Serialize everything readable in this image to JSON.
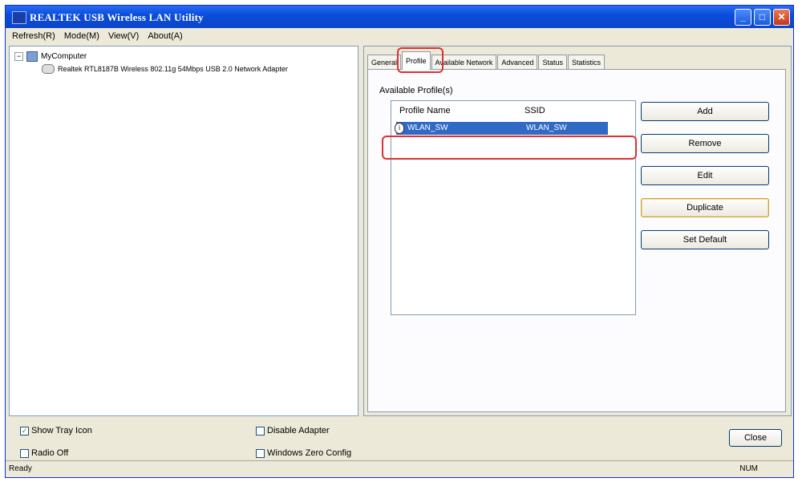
{
  "window": {
    "title": "REALTEK USB Wireless LAN Utility"
  },
  "menu": [
    "Refresh(R)",
    "Mode(M)",
    "View(V)",
    "About(A)"
  ],
  "tree": {
    "root": "MyComputer",
    "child": "Realtek RTL8187B Wireless 802.11g 54Mbps USB 2.0 Network Adapter"
  },
  "tabs": [
    "General",
    "Profile",
    "Available Network",
    "Advanced",
    "Status",
    "Statistics"
  ],
  "profile": {
    "section_label": "Available Profile(s)",
    "columns": [
      "Profile Name",
      "SSID"
    ],
    "rows": [
      {
        "name": "WLAN_SW",
        "ssid": "WLAN_SW"
      }
    ],
    "buttons": [
      "Add",
      "Remove",
      "Edit",
      "Duplicate",
      "Set Default"
    ]
  },
  "options": {
    "show_tray_icon": "Show Tray Icon",
    "radio_off": "Radio Off",
    "disable_adapter": "Disable Adapter",
    "windows_zero_config": "Windows Zero Config"
  },
  "close_label": "Close",
  "status": {
    "left": "Ready",
    "right": "NUM"
  }
}
